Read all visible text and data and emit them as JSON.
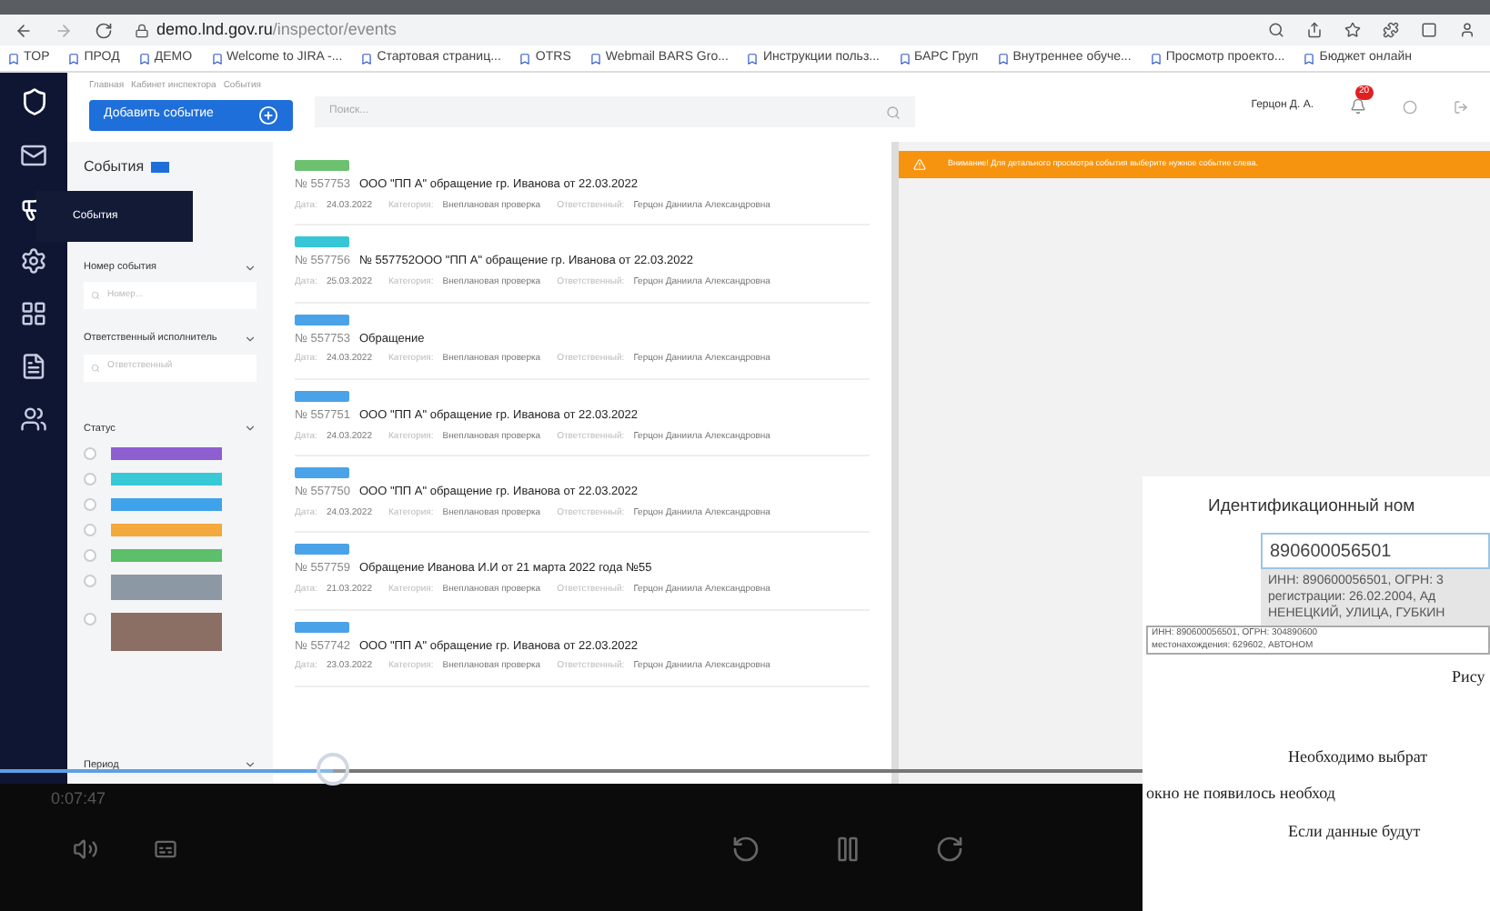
{
  "browser": {
    "url_host": "demo.lnd.gov.ru",
    "url_path": "/inspector/events",
    "bookmarks": [
      {
        "label": "TOP"
      },
      {
        "label": "ПРОД"
      },
      {
        "label": "ДЕМО"
      },
      {
        "label": "Welcome to JIRA -..."
      },
      {
        "label": "Стартовая страниц..."
      },
      {
        "label": "OTRS"
      },
      {
        "label": "Webmail BARS Gro..."
      },
      {
        "label": "Инструкции польз..."
      },
      {
        "label": "БАРС Груп"
      },
      {
        "label": "Внутреннее обуче..."
      },
      {
        "label": "Просмотр проекто..."
      },
      {
        "label": "Бюджет онлайн"
      }
    ]
  },
  "nav": {
    "tooltip": "События",
    "items": [
      {
        "kind": "mail",
        "selected": false
      },
      {
        "kind": "megaphone",
        "selected": true
      },
      {
        "kind": "gears",
        "selected": false
      },
      {
        "kind": "grid",
        "selected": false
      },
      {
        "kind": "document",
        "selected": false
      },
      {
        "kind": "people",
        "selected": false
      }
    ]
  },
  "header": {
    "breadcrumbs": [
      "Главная",
      "Кабинет инспектора",
      "События"
    ],
    "add_button": "Добавить событие",
    "search_placeholder": "Поиск...",
    "user": "Герцон Д. А.",
    "notifications": "20"
  },
  "filters": {
    "title": "События",
    "fields": [
      {
        "label": "Номер события",
        "placeholder": "Номер..."
      },
      {
        "label": "Ответственный исполнитель",
        "placeholder": "Ответственный"
      }
    ],
    "status_label": "Статус",
    "statuses": [
      {
        "color": "#8e5fd0",
        "checked": false,
        "kind": "short"
      },
      {
        "color": "#38c9d6",
        "checked": false,
        "kind": "short"
      },
      {
        "color": "#3fa3ec",
        "checked": false,
        "kind": "short"
      },
      {
        "color": "#f3a93b",
        "checked": false,
        "kind": "short"
      },
      {
        "color": "#5cbf6a",
        "checked": false,
        "kind": "short"
      },
      {
        "color": "#8c98a3",
        "checked": false,
        "kind": "medium"
      },
      {
        "color": "#8b6e64",
        "checked": false,
        "kind": "tall"
      }
    ],
    "next_label": "Период"
  },
  "events": [
    {
      "color": "#6cc070",
      "number": "№ 557753",
      "title": "ООО \"ПП А\" обращение гр. Иванова от 22.03.2022",
      "date_label": "Дата:",
      "date": "24.03.2022",
      "category_label": "Категория:",
      "category": "Внеплановая проверка",
      "responsible_label": "Ответственный:",
      "responsible": "Герцон Даниила Александровна"
    },
    {
      "color": "#37c6d6",
      "number": "№ 557756",
      "title": "№ 557752ООО \"ПП А\" обращение гр. Иванова от 22.03.2022",
      "date_label": "Дата:",
      "date": "25.03.2022",
      "category_label": "Категория:",
      "category": "Внеплановая проверка",
      "responsible_label": "Ответственный:",
      "responsible": "Герцон Даниила Александровна"
    },
    {
      "color": "#4aa3e8",
      "number": "№ 557753",
      "title": "Обращение",
      "date_label": "Дата:",
      "date": "24.03.2022",
      "category_label": "Категория:",
      "category": "Внеплановая проверка",
      "responsible_label": "Ответственный:",
      "responsible": "Герцон Даниила Александровна"
    },
    {
      "color": "#4aa3e8",
      "number": "№ 557751",
      "title": "ООО \"ПП А\" обращение гр. Иванова от 22.03.2022",
      "date_label": "Дата:",
      "date": "24.03.2022",
      "category_label": "Категория:",
      "category": "Внеплановая проверка",
      "responsible_label": "Ответственный:",
      "responsible": "Герцон Даниила Александровна"
    },
    {
      "color": "#4aa3e8",
      "number": "№ 557750",
      "title": "ООО \"ПП А\" обращение гр. Иванова от 22.03.2022",
      "date_label": "Дата:",
      "date": "24.03.2022",
      "category_label": "Категория:",
      "category": "Внеплановая проверка",
      "responsible_label": "Ответственный:",
      "responsible": "Герцон Даниила Александровна"
    },
    {
      "color": "#4aa3e8",
      "number": "№ 557759",
      "title": "Обращение Иванова И.И от 21 марта 2022 года №55",
      "date_label": "Дата:",
      "date": "21.03.2022",
      "category_label": "Категория:",
      "category": "Внеплановая проверка",
      "responsible_label": "Ответственный:",
      "responsible": "Герцон Даниила Александровна"
    },
    {
      "color": "#4aa3e8",
      "number": "№ 557742",
      "title": "ООО \"ПП А\" обращение гр. Иванова от 22.03.2022",
      "date_label": "Дата:",
      "date": "23.03.2022",
      "category_label": "Категория:",
      "category": "Внеплановая проверка",
      "responsible_label": "Ответственный:",
      "responsible": "Герцон Даниила Александровна"
    }
  ],
  "alert": "Внимание! Для детального просмотра события выберите нужное событие слева.",
  "player": {
    "time": "0:07:47",
    "level": 0.29
  },
  "document": {
    "label": "Идентификационный ном",
    "input": "890600056501",
    "suggestion": [
      "ИНН: 890600056501, ОГРН: 3",
      "регистрации: 26.02.2004, Ад",
      "НЕНЕЦКИЙ, УЛИЦА, ГУБКИН"
    ],
    "tooltip": [
      "ИНН: 890600056501, ОГРН: 304890600",
      "местонахождения: 629602, АВТОНОМ"
    ],
    "caption": "Рису",
    "paragraph": [
      "Необходимо выбрат",
      "окно не появилось необход",
      "Если данные будут"
    ]
  }
}
